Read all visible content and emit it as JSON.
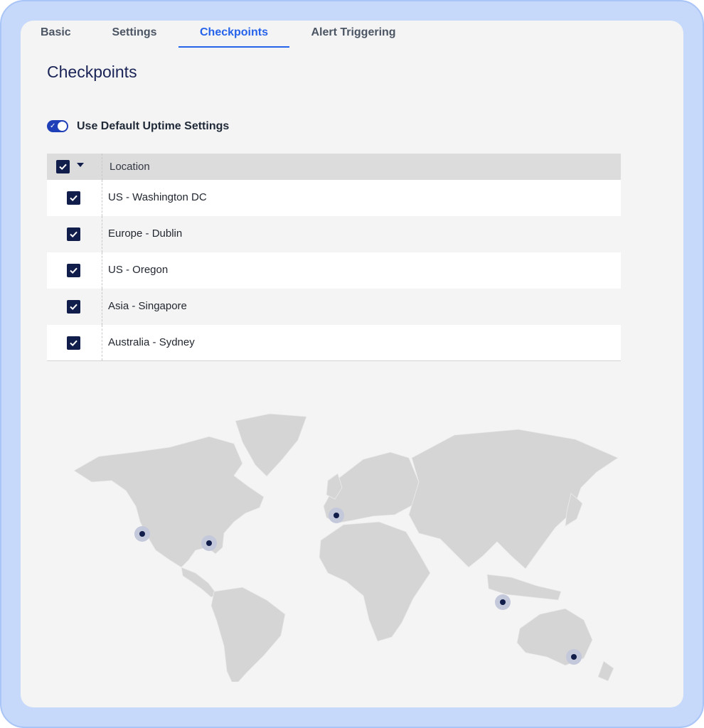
{
  "tabs": [
    {
      "label": "Basic",
      "active": false
    },
    {
      "label": "Settings",
      "active": false
    },
    {
      "label": "Checkpoints",
      "active": true
    },
    {
      "label": "Alert Triggering",
      "active": false
    }
  ],
  "page_title": "Checkpoints",
  "toggle": {
    "label": "Use Default Uptime Settings",
    "on": true
  },
  "table": {
    "header": "Location",
    "rows": [
      {
        "label": "US - Washington DC",
        "checked": true
      },
      {
        "label": "Europe - Dublin",
        "checked": true
      },
      {
        "label": "US - Oregon",
        "checked": true
      },
      {
        "label": "Asia - Singapore",
        "checked": true
      },
      {
        "label": "Australia - Sydney",
        "checked": true
      }
    ]
  },
  "map": {
    "icon": "world-map",
    "markers": [
      "US - Oregon",
      "US - Washington DC",
      "Europe - Dublin",
      "Asia - Singapore",
      "Australia - Sydney"
    ]
  },
  "colors": {
    "accent": "#2563eb",
    "navy": "#111d4a",
    "toggle": "#1f3fb8",
    "map_land": "#d5d5d6",
    "marker_halo": "#c3c8da"
  }
}
